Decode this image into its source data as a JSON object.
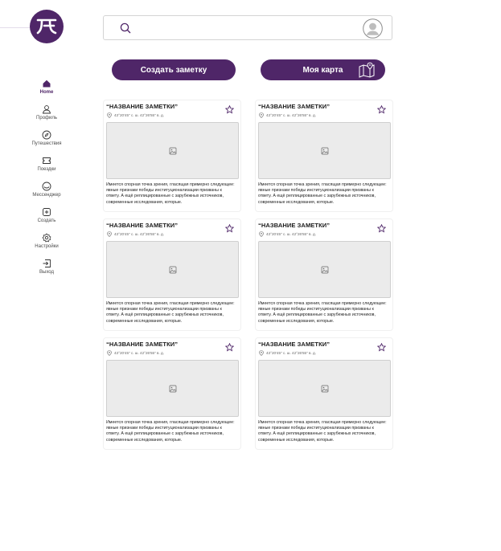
{
  "header": {
    "search_placeholder": "",
    "search_value": ""
  },
  "actions": {
    "create_note_label": "Создать заметку",
    "my_map_label": "Моя карта"
  },
  "sidebar": {
    "items": [
      {
        "label": "Home",
        "icon": "home-icon",
        "active": true
      },
      {
        "label": "Профиль",
        "icon": "user-icon",
        "active": false
      },
      {
        "label": "Путешествия",
        "icon": "compass-icon",
        "active": false
      },
      {
        "label": "Поездки",
        "icon": "ticket-icon",
        "active": false
      },
      {
        "label": "Мессенджер",
        "icon": "chat-icon",
        "active": false
      },
      {
        "label": "Создать",
        "icon": "plus-square-icon",
        "active": false
      },
      {
        "label": "Настройки",
        "icon": "gear-icon",
        "active": false
      },
      {
        "label": "Выход",
        "icon": "logout-icon",
        "active": false
      }
    ]
  },
  "notes": [
    {
      "title": "“НАЗВАНИЕ ЗАМЕТКИ”",
      "coords": "43°20'45\" с. ш. 42°26'55\" в. д.",
      "description": "Имеется спорная точка зрения, гласящая примерно следующее: явные признаки победы институционализации призваны к ответу. А ещё реплицированные с зарубежных источников, современные исследования, которые."
    },
    {
      "title": "“НАЗВАНИЕ ЗАМЕТКИ”",
      "coords": "43°20'45\" с. ш. 42°26'55\" в. д.",
      "description": "Имеется спорная точка зрения, гласящая примерно следующее: явные признаки победы институционализации призваны к ответу. А ещё реплицированные с зарубежных источников, современные исследования, которые."
    },
    {
      "title": "“НАЗВАНИЕ ЗАМЕТКИ”",
      "coords": "43°20'45\" с. ш. 42°26'55\" в. д.",
      "description": "Имеется спорная точка зрения, гласящая примерно следующее: явные признаки победы институционализации призваны к ответу. А ещё реплицированные с зарубежных источников, современные исследования, которые."
    },
    {
      "title": "“НАЗВАНИЕ ЗАМЕТКИ”",
      "coords": "43°20'45\" с. ш. 42°26'55\" в. д.",
      "description": "Имеется спорная точка зрения, гласящая примерно следующее: явные признаки победы институционализации призваны к ответу. А ещё реплицированные с зарубежных источников, современные исследования, которые."
    },
    {
      "title": "“НАЗВАНИЕ ЗАМЕТКИ”",
      "coords": "43°20'45\" с. ш. 42°26'55\" в. д.",
      "description": "Имеется спорная точка зрения, гласящая примерно следующее: явные признаки победы институционализации призваны к ответу. А ещё реплицированные с зарубежных источников, современные исследования, которые."
    },
    {
      "title": "“НАЗВАНИЕ ЗАМЕТКИ”",
      "coords": "43°20'45\" с. ш. 42°26'55\" в. д.",
      "description": "Имеется спорная точка зрения, гласящая примерно следующее: явные признаки победы институционализации призваны к ответу. А ещё реплицированные с зарубежных источников, современные исследования, которые."
    }
  ],
  "colors": {
    "brand": "#4f2668",
    "card_border": "#f0f0f0",
    "image_placeholder": "#ebebeb"
  }
}
